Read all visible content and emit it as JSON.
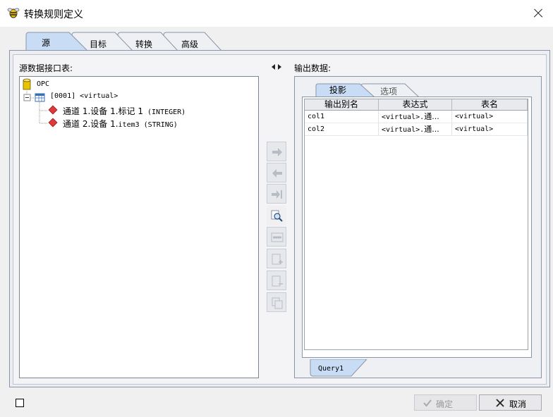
{
  "window": {
    "title": "转换规则定义",
    "icon": "bee-app-icon"
  },
  "tabs": [
    {
      "label": "源",
      "active": true
    },
    {
      "label": "目标",
      "active": false
    },
    {
      "label": "转换",
      "active": false
    },
    {
      "label": "高级",
      "active": false
    }
  ],
  "source": {
    "label": "源数据接口表:",
    "tree": {
      "root": "OPC",
      "table": "[0001] <virtual>",
      "items": [
        {
          "cjk": "通道 1.设备 1.标记 1",
          "type": " (INTEGER)"
        },
        {
          "cjk": "通道 2.设备 1.",
          "name": "item3 (STRING)"
        }
      ]
    }
  },
  "toolbar": {
    "icons": [
      "arrow-right-icon",
      "arrow-left-icon",
      "arrow-to-end-icon",
      "magnifier-icon",
      "sql-icon",
      "edit-add-icon",
      "edit-remove-icon",
      "copy-icon"
    ]
  },
  "output": {
    "label": "输出数据:",
    "tabs": [
      {
        "label": "投影",
        "active": true
      },
      {
        "label": "选项",
        "active": false
      }
    ],
    "columns": [
      "输出别名",
      "表达式",
      "表名"
    ],
    "rows": [
      {
        "alias": "col1",
        "expr_a": "<virtual>.",
        "expr_b": "通...",
        "table": "<virtual>"
      },
      {
        "alias": "col2",
        "expr_a": "<virtual>.",
        "expr_b": "通...",
        "table": "<virtual>"
      }
    ],
    "query_tab": "Query1"
  },
  "buttons": {
    "ok": "确定",
    "cancel": "取消"
  },
  "colors": {
    "accent_tab": "#c9dcf5",
    "tree_root_icon": "#e8c400",
    "item_icon": "#e0383a"
  }
}
